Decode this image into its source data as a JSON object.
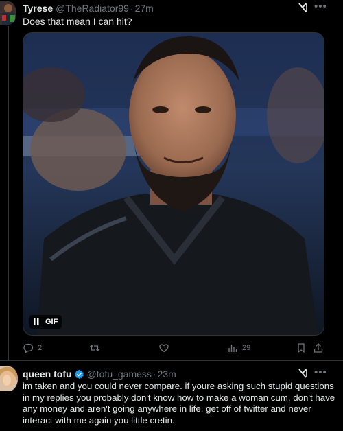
{
  "tweet1": {
    "author_name": "Tyrese",
    "author_handle": "@TheRadiator99",
    "time": "27m",
    "text": "Does that mean I can hit?",
    "media_badge": "GIF",
    "actions": {
      "replies": "2",
      "retweets": "",
      "likes": "",
      "views": "29"
    }
  },
  "tweet2": {
    "author_name": "queen tofu",
    "author_handle": "@tofu_gamess",
    "time": "23m",
    "text": "im taken and you could never compare. if youre asking such stupid questions in my replies you probably don't know how to make a woman cum, don't have any money and aren't going anywhere in life. get off of twitter and never interact with me again you little cretin."
  },
  "icons": [
    "grok-icon",
    "more-icon",
    "reply-icon",
    "retweet-icon",
    "like-icon",
    "views-icon",
    "bookmark-icon",
    "share-icon",
    "verified-icon",
    "pause-icon"
  ],
  "colors": {
    "background": "#000000",
    "text": "#e7e9ea",
    "secondary": "#71767b",
    "border": "#2f3336",
    "verified": "#1d9bf0"
  }
}
